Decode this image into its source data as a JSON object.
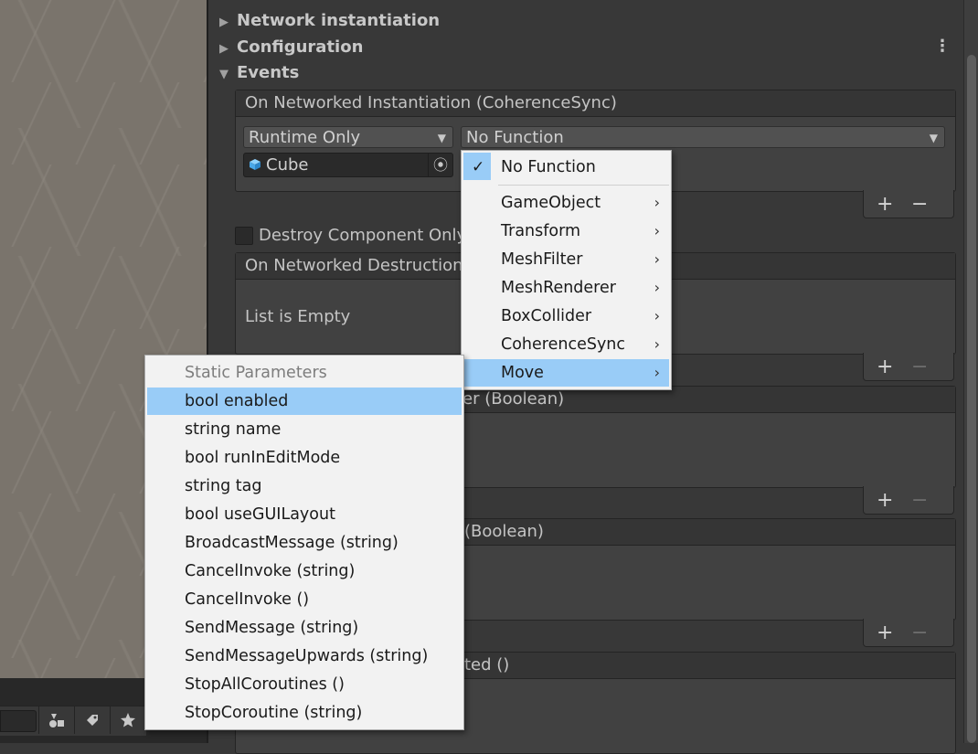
{
  "inspector": {
    "foldouts": [
      {
        "label": "Network instantiation",
        "expanded": false
      },
      {
        "label": "Configuration",
        "expanded": false
      },
      {
        "label": "Events",
        "expanded": true
      }
    ],
    "event_instantiation": {
      "header": "On Networked Instantiation (CoherenceSync)",
      "runtime_dropdown": "Runtime Only",
      "function_dropdown": "No Function",
      "object_field": "Cube"
    },
    "destroy_component_only_label": "Destroy Component Only",
    "event_destruction": {
      "header": "On Networked Destruction",
      "empty_text": "List is Empty"
    },
    "event3_header_fragment": "er (Boolean)",
    "event4_header_fragment": "(Boolean)",
    "event5_header_fragment": "ted ()",
    "add_symbol": "+",
    "remove_symbol": "−"
  },
  "function_menu": {
    "items": [
      {
        "label": "No Function",
        "checked": true,
        "submenu": false
      },
      {
        "label": "GameObject",
        "submenu": true
      },
      {
        "label": "Transform",
        "submenu": true
      },
      {
        "label": "MeshFilter",
        "submenu": true
      },
      {
        "label": "MeshRenderer",
        "submenu": true
      },
      {
        "label": "BoxCollider",
        "submenu": true
      },
      {
        "label": "CoherenceSync",
        "submenu": true
      },
      {
        "label": "Move",
        "submenu": true,
        "highlighted": true
      }
    ]
  },
  "submenu": {
    "header": "Static Parameters",
    "items": [
      {
        "label": "bool enabled",
        "highlighted": true
      },
      {
        "label": "string name"
      },
      {
        "label": "bool runInEditMode"
      },
      {
        "label": "string tag"
      },
      {
        "label": "bool useGUILayout"
      },
      {
        "label": "BroadcastMessage (string)"
      },
      {
        "label": "CancelInvoke (string)"
      },
      {
        "label": "CancelInvoke ()"
      },
      {
        "label": "SendMessage (string)"
      },
      {
        "label": "SendMessageUpwards (string)"
      },
      {
        "label": "StopAllCoroutines ()"
      },
      {
        "label": "StopCoroutine (string)"
      }
    ]
  },
  "icons": {
    "kebab": "⋮",
    "foldout_collapsed": "▶",
    "foldout_expanded": "▼",
    "dropdown_caret": "▼",
    "chevron": "›",
    "checkmark": "✓",
    "target": "⦿"
  },
  "colors": {
    "highlight": "#99ccf7",
    "menu_bg": "#f2f2f2",
    "inspector_bg": "#383838"
  }
}
